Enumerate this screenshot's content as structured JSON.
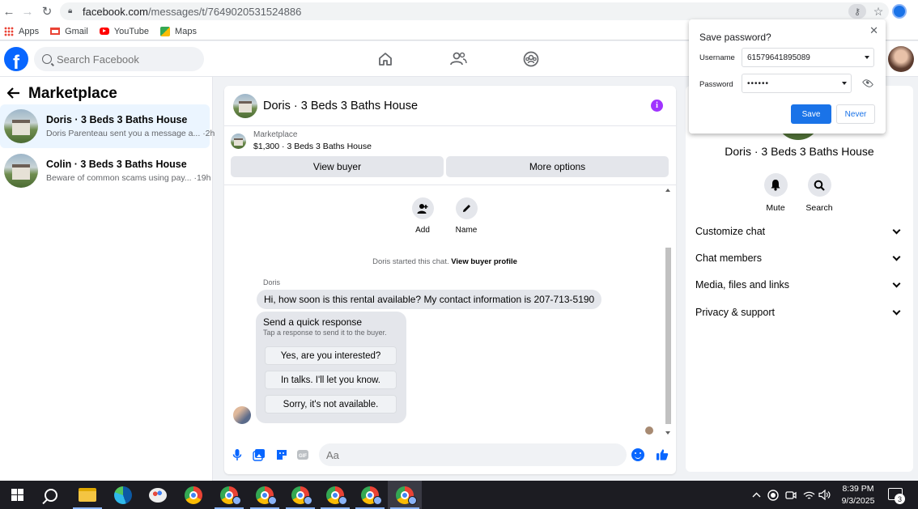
{
  "browser": {
    "url_host": "facebook.com",
    "url_path": "/messages/t/7649020531524886",
    "bookmarks": [
      {
        "label": "Apps",
        "icon": "apps-grid-icon"
      },
      {
        "label": "Gmail",
        "icon": "gmail-icon"
      },
      {
        "label": "YouTube",
        "icon": "youtube-icon"
      },
      {
        "label": "Maps",
        "icon": "maps-icon"
      }
    ]
  },
  "fb_header": {
    "logo": "f",
    "search_placeholder": "Search Facebook"
  },
  "left_pane": {
    "title": "Marketplace",
    "conversations": [
      {
        "title": "Doris · 3 Beds 3 Baths House",
        "preview": "Doris Parenteau sent you a message a... ·2h",
        "active": true
      },
      {
        "title": "Colin · 3 Beds 3 Baths House",
        "preview": "Beware of common scams using pay... ·19h",
        "active": false
      }
    ]
  },
  "chat": {
    "title": "Doris · 3 Beds 3 Baths House",
    "listing_kind": "Marketplace",
    "listing_price": "$1,300 · 3 Beds 3 Baths House",
    "view_buyer_label": "View buyer",
    "more_options_label": "More options",
    "quick_actions": [
      {
        "label": "Add",
        "icon": "add-person-icon"
      },
      {
        "label": "Name",
        "icon": "pencil-icon"
      }
    ],
    "started_text": "Doris started this chat.",
    "view_profile_link": "View buyer profile",
    "sender_name": "Doris",
    "message": "Hi, how soon is this rental available? My contact information is 207-713-5190",
    "quick_response": {
      "title": "Send a quick response",
      "subtitle": "Tap a response to send it to the buyer.",
      "options": [
        "Yes, are you interested?",
        "In talks. I'll let you know.",
        "Sorry, it's not available."
      ]
    },
    "composer_placeholder": "Aa"
  },
  "right_panel": {
    "title": "Doris · 3 Beds 3 Baths House",
    "actions": [
      {
        "label": "Mute",
        "icon": "bell-icon"
      },
      {
        "label": "Search",
        "icon": "search-icon"
      }
    ],
    "sections": [
      "Customize chat",
      "Chat members",
      "Media, files and links",
      "Privacy & support"
    ]
  },
  "password_popup": {
    "title": "Save password?",
    "username_label": "Username",
    "username_value": "61579641895089",
    "password_label": "Password",
    "password_value": "••••••",
    "save_label": "Save",
    "never_label": "Never"
  },
  "taskbar": {
    "time": "8:39 PM",
    "date": "9/3/2025",
    "notification_count": "3"
  },
  "colors": {
    "fb_blue": "#0866ff",
    "chrome_blue": "#1a73e8",
    "info_purple": "#a033ff",
    "active_conversation": "#ebf5ff"
  }
}
